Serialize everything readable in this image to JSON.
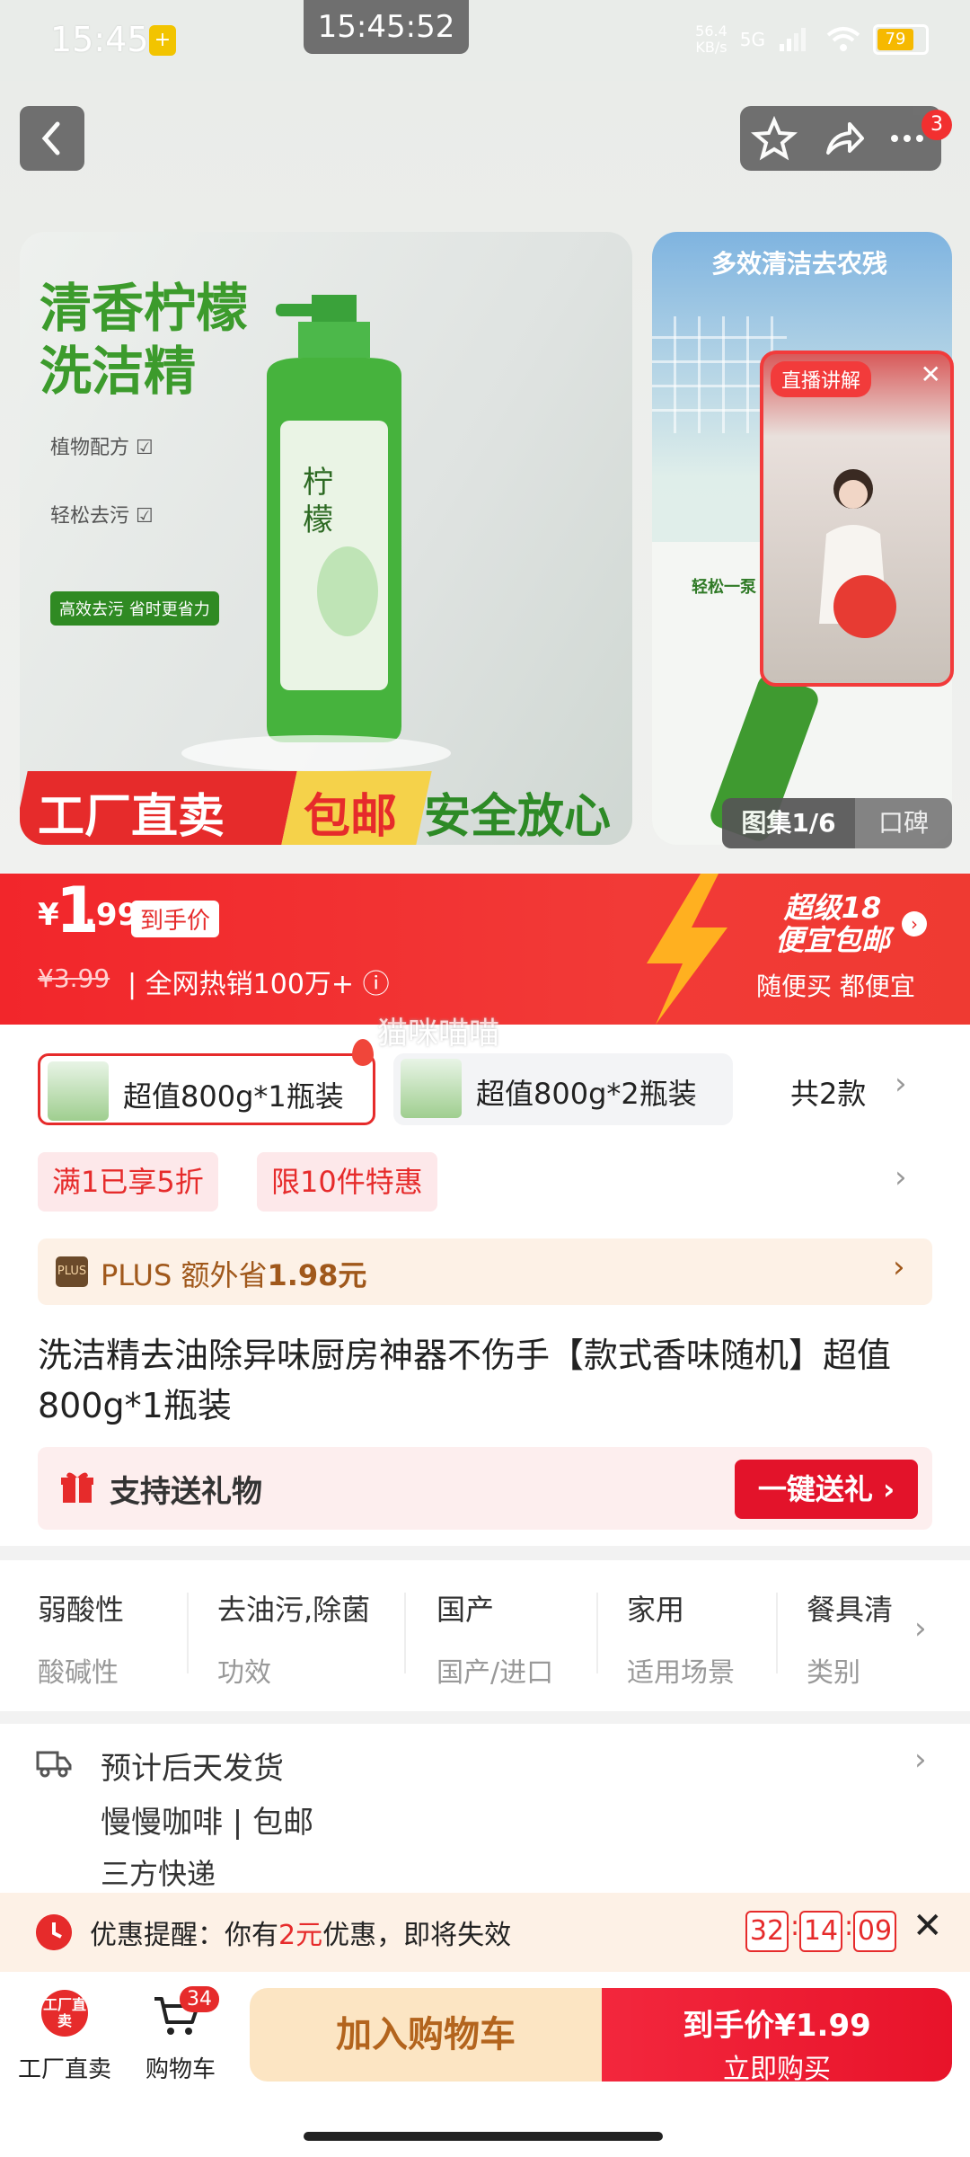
{
  "status_bar": {
    "time": "15:45",
    "overlay_time": "15:45:52",
    "net_speed": "56.4",
    "net_unit": "KB/s",
    "net_type": "5G",
    "battery": "79"
  },
  "header": {
    "badge_count": "3"
  },
  "main_image": {
    "title_line1": "清香柠檬",
    "title_line2": "洗洁精",
    "feature1": "植物配方 ☑",
    "feature2": "轻松去污 ☑",
    "feature_badge": "高效去污 省时更省力",
    "banner1": "工厂直卖",
    "banner2": "包邮",
    "banner3": "安全放心"
  },
  "side_image": {
    "title": "多效清洁去农残",
    "subtitle": "轻松一泵"
  },
  "live": {
    "tag": "直播讲解",
    "close": "✕"
  },
  "gallery": {
    "label": "图集1/6",
    "label2": "口碑"
  },
  "price": {
    "currency": "¥",
    "integer": "1",
    "decimal": ".99",
    "tag": "到手价",
    "original": "¥3.99",
    "sales": "| 全网热销100万+ ⓘ"
  },
  "promo": {
    "line1": "超级18",
    "line2": "便宜包邮",
    "sub": "随便买 都便宜"
  },
  "watermark": "猫咪喵喵",
  "specs": {
    "options": [
      {
        "label": "超值800g*1瓶装"
      },
      {
        "label": "超值800g*2瓶装"
      }
    ],
    "count": "共2款"
  },
  "tags": [
    "满1已享5折",
    "限10件特惠"
  ],
  "plus": {
    "logo": "PLUS",
    "text_pre": "PLUS 额外省",
    "amount": "1.98元"
  },
  "title": "洗洁精去油除异味厨房神器不伤手【款式香味随机】超值800g*1瓶装",
  "gift": {
    "label": "支持送礼物",
    "button": "一键送礼 ›"
  },
  "attributes": [
    {
      "value": "弱酸性",
      "key": "酸碱性"
    },
    {
      "value": "去油污,除菌",
      "key": "功效"
    },
    {
      "value": "国产",
      "key": "国产/进口"
    },
    {
      "value": "家用",
      "key": "适用场景"
    },
    {
      "value": "餐具清",
      "key": "类别"
    }
  ],
  "shipping": {
    "line1": "预计后天发货",
    "line2": "慢慢咖啡 | 包邮",
    "line3": "三方快递"
  },
  "reminder": {
    "prefix": "优惠提醒：你有",
    "amount": "2元",
    "suffix": "优惠，即将失效",
    "timer": [
      "32",
      "14",
      "09"
    ]
  },
  "bottom": {
    "factory_icon": "工厂直卖",
    "factory_label": "工厂直卖",
    "cart_label": "购物车",
    "cart_badge": "34",
    "add_cart": "加入购物车",
    "buy_line1": "到手价¥1.99",
    "buy_line2": "立即购买"
  },
  "colors": {
    "accent_red": "#e62b2b",
    "plus_brown": "#a0581b",
    "green": "#3c9b2c"
  }
}
